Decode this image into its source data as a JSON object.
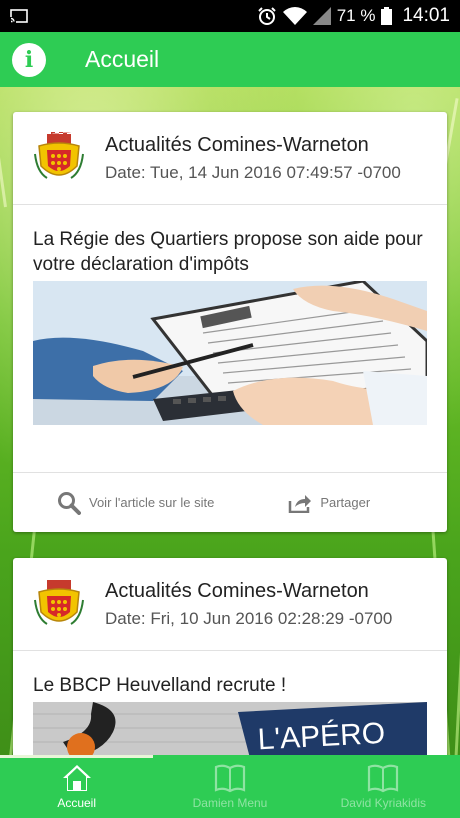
{
  "status_bar": {
    "battery": "71 %",
    "time": "14:01"
  },
  "app_bar": {
    "info_glyph": "i",
    "title": "Accueil"
  },
  "cards": [
    {
      "source": "Actualités Comines-Warneton",
      "date": "Date: Tue, 14 Jun 2016 07:49:57 -0700",
      "title": "La Régie des Quartiers propose son aide pour votre déclaration d'impôts",
      "actions": {
        "view": "Voir l'article sur le site",
        "share": "Partager"
      }
    },
    {
      "source": "Actualités Comines-Warneton",
      "date": "Date: Fri, 10 Jun 2016 02:28:29 -0700",
      "title": "Le BBCP Heuvelland recrute !",
      "image_text": "L'APÉRO"
    }
  ],
  "bottom_nav": [
    {
      "label": "Accueil",
      "icon": "home-icon",
      "active": true
    },
    {
      "label": "Damien Menu",
      "icon": "book-icon",
      "active": false
    },
    {
      "label": "David Kyriakidis",
      "icon": "book-icon",
      "active": false
    }
  ],
  "colors": {
    "primary_green": "#2ecc54",
    "inactive_nav": "#8fe3a3"
  }
}
